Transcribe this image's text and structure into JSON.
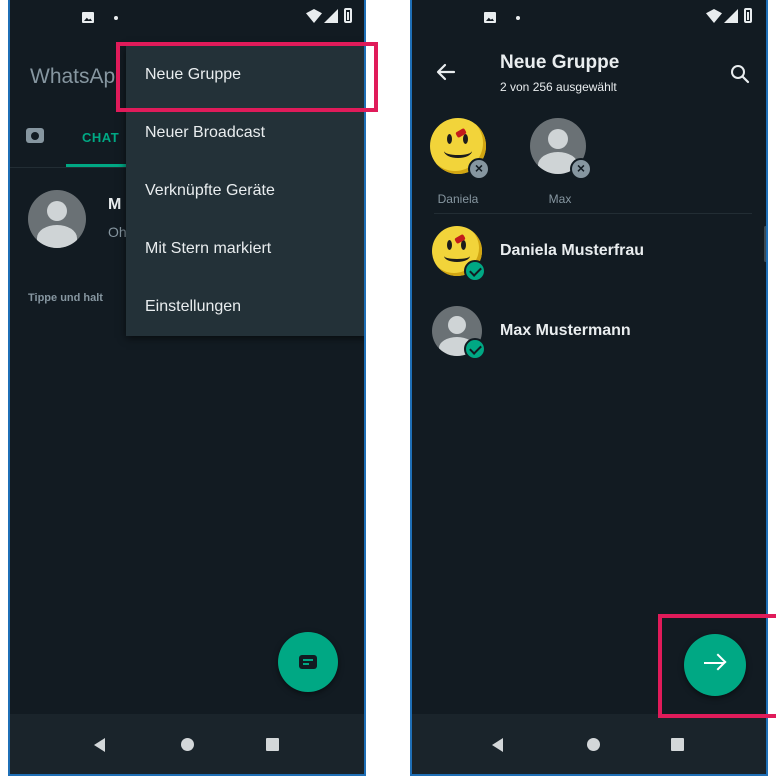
{
  "left_screen": {
    "app_title": "WhatsAp",
    "tabs": {
      "chats_label": "CHAT"
    },
    "chat_item": {
      "name": "M",
      "subtitle": "Oh"
    },
    "hint": "Tippe und halt",
    "menu": {
      "items": [
        {
          "label": "Neue Gruppe",
          "highlighted": true
        },
        {
          "label": "Neuer Broadcast"
        },
        {
          "label": "Verknüpfte Geräte"
        },
        {
          "label": "Mit Stern markiert"
        },
        {
          "label": "Einstellungen"
        }
      ]
    },
    "fab": {
      "icon": "new-chat-icon"
    }
  },
  "right_screen": {
    "header": {
      "title": "Neue Gruppe",
      "subtitle": "2 von 256 ausgewählt"
    },
    "selected_chips": [
      {
        "label": "Daniela",
        "avatar": "smiley-avatar"
      },
      {
        "label": "Max",
        "avatar": "default-avatar"
      }
    ],
    "contacts": [
      {
        "name": "Daniela Musterfrau",
        "selected": true,
        "avatar": "smiley-avatar"
      },
      {
        "name": "Max Mustermann",
        "selected": true,
        "avatar": "default-avatar"
      }
    ],
    "fab": {
      "icon": "arrow-right-icon",
      "highlighted": true
    }
  },
  "colors": {
    "background": "#121b22",
    "accent": "#00a884",
    "menu_background": "#233138",
    "highlight": "#e01b5a",
    "text_primary": "#e9edef",
    "text_secondary": "#8696a0"
  }
}
